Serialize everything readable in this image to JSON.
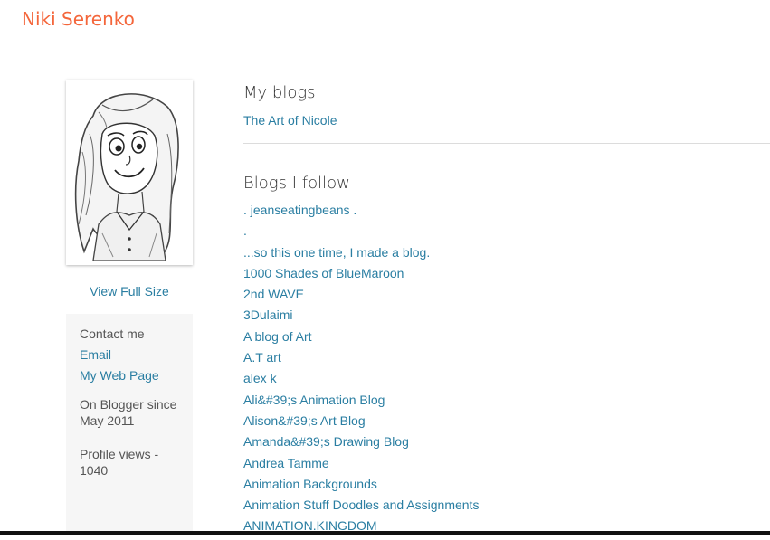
{
  "header": {
    "title": "Niki Serenko"
  },
  "profile": {
    "view_full_size": "View Full Size",
    "contact_heading": "Contact me",
    "email_label": "Email",
    "web_page_label": "My Web Page",
    "blogger_since": "On Blogger since May 2011",
    "profile_views": "Profile views - 1040"
  },
  "my_blogs": {
    "title": "My blogs",
    "items": [
      "The Art of Nicole"
    ]
  },
  "blogs_i_follow": {
    "title": "Blogs I follow",
    "items": [
      ". jeanseatingbeans .",
      ".",
      "...so this one time, I made a blog.",
      "1000 Shades of BlueMaroon",
      "2nd WAVE",
      "3Dulaimi",
      "A blog of Art",
      "A.T art",
      "alex k",
      "Ali&#39;s Animation Blog",
      "Alison&#39;s Art Blog",
      "Amanda&#39;s Drawing Blog",
      "Andrea Tamme",
      "Animation Backgrounds",
      "Animation Stuff Doodles and Assignments",
      "ANIMATION.KINGDOM"
    ]
  },
  "colors": {
    "title": "#f4663b",
    "link": "#2a7ea2",
    "text": "#555555",
    "sidebar_bg": "#f6f6f6"
  }
}
